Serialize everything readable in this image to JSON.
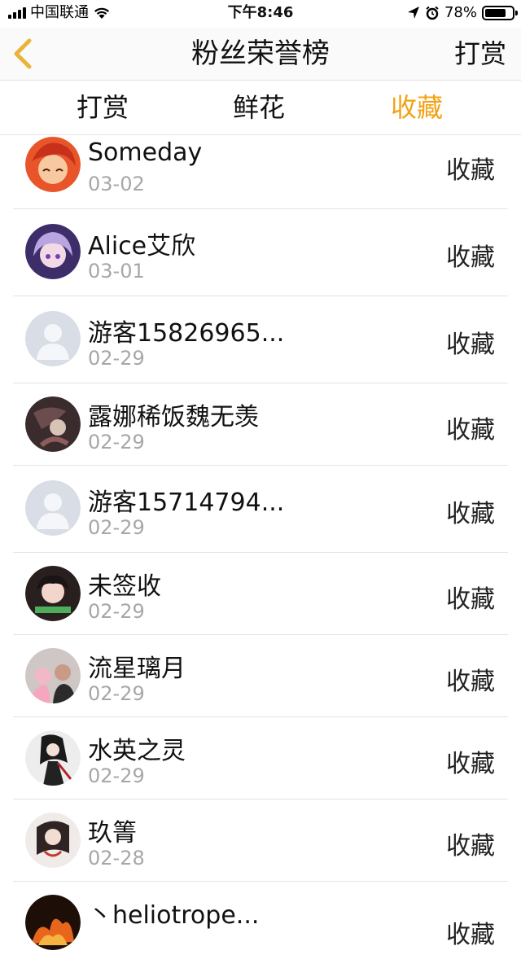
{
  "status_bar": {
    "carrier": "中国联通",
    "time": "下午8:46",
    "battery": "78%",
    "battery_level": 0.78
  },
  "nav": {
    "title": "粉丝荣誉榜",
    "right_label": "打赏",
    "back_icon": "chevron-left-icon",
    "back_color": "#e8b43a"
  },
  "tabs": [
    {
      "label": "打赏"
    },
    {
      "label": "鲜花"
    },
    {
      "label": "收藏"
    }
  ],
  "active_tab_color": "#f2a315",
  "items": [
    {
      "name": "Someday",
      "date": "03-02",
      "action": "收藏",
      "avatar": "anime-redhead"
    },
    {
      "name": "Alice艾欣",
      "date": "03-01",
      "action": "收藏",
      "avatar": "anime-purple"
    },
    {
      "name": "游客15826965...",
      "date": "02-29",
      "action": "收藏",
      "avatar": "default-user"
    },
    {
      "name": "露娜稀饭魏无羡",
      "date": "02-29",
      "action": "收藏",
      "avatar": "dark-illustration"
    },
    {
      "name": "游客15714794...",
      "date": "02-29",
      "action": "收藏",
      "avatar": "default-user"
    },
    {
      "name": "未签收",
      "date": "02-29",
      "action": "收藏",
      "avatar": "photo-girl"
    },
    {
      "name": "流星璃月",
      "date": "02-29",
      "action": "收藏",
      "avatar": "photo-couple"
    },
    {
      "name": "水英之灵",
      "date": "02-29",
      "action": "收藏",
      "avatar": "dark-character"
    },
    {
      "name": "玖箐",
      "date": "02-28",
      "action": "收藏",
      "avatar": "ancient-style"
    },
    {
      "name": "丶heliotrope...",
      "date": "",
      "action": "收藏",
      "avatar": "fire-avatar"
    }
  ]
}
